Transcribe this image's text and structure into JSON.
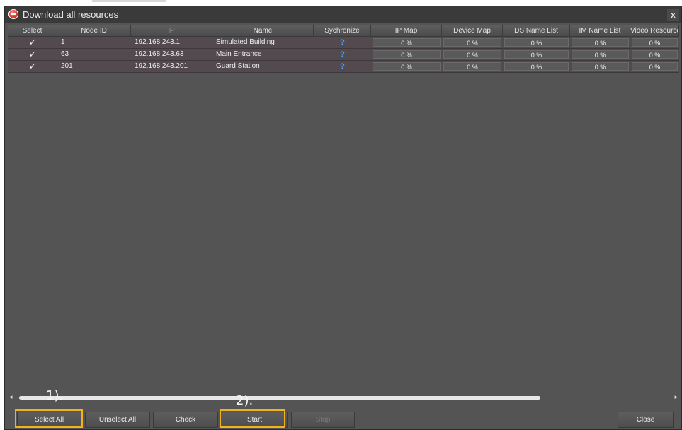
{
  "window": {
    "title": "Download all resources",
    "close_glyph": "x"
  },
  "columns": [
    "Select",
    "Node ID",
    "IP",
    "Name",
    "Sychronize",
    "IP Map",
    "Device Map",
    "DS Name List",
    "IM Name List",
    "Video Resources"
  ],
  "rows": [
    {
      "checked": "✓",
      "node_id": "1",
      "ip": "192.168.243.1",
      "name": "Simulated Building",
      "sync": "?",
      "ip_map": "0 %",
      "device_map": "0 %",
      "ds_name_list": "0 %",
      "im_name_list": "0 %",
      "video_resources": "0 %"
    },
    {
      "checked": "✓",
      "node_id": "63",
      "ip": "192.168.243.63",
      "name": "Main Entrance",
      "sync": "?",
      "ip_map": "0 %",
      "device_map": "0 %",
      "ds_name_list": "0 %",
      "im_name_list": "0 %",
      "video_resources": "0 %"
    },
    {
      "checked": "✓",
      "node_id": "201",
      "ip": "192.168.243.201",
      "name": "Guard Station",
      "sync": "?",
      "ip_map": "0 %",
      "device_map": "0 %",
      "ds_name_list": "0 %",
      "im_name_list": "0 %",
      "video_resources": "0 %"
    }
  ],
  "buttons": {
    "select_all": "Select All",
    "unselect_all": "Unselect All",
    "check": "Check",
    "start": "Start",
    "stop": "Stop",
    "close": "Close"
  },
  "annotations": {
    "step1": "1).",
    "step2": "2)."
  },
  "scrollbar": {
    "left_arrow": "◂",
    "right_arrow": "▸"
  },
  "colors": {
    "highlight": "#f2b21b",
    "app_icon": "#d02a20",
    "sync_icon": "#4aa3ff"
  },
  "icons": {
    "app": "app-logo-icon",
    "close": "close-icon",
    "check": "checkmark-icon",
    "sync": "question-icon"
  }
}
